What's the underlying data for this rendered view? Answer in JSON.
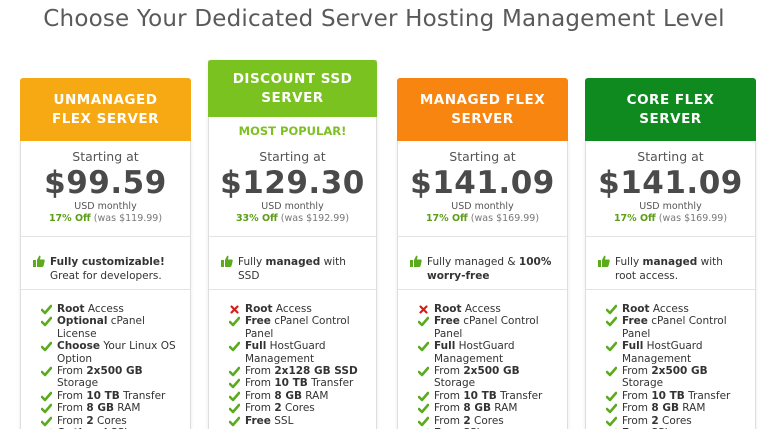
{
  "page_title": "Choose Your Dedicated Server Hosting Management Level",
  "colors": {
    "orange": "#f6a913",
    "green_light": "#7ac21f",
    "orange_dark": "#f7850f",
    "green_dark": "#0f8a1e",
    "check": "#5cab1e",
    "cross": "#d4201b"
  },
  "plans": [
    {
      "name": "UNMANAGED FLEX SERVER",
      "starting": "Starting at",
      "price": "$99.59",
      "per": "USD monthly",
      "discount_pct": "17% Off",
      "discount_was": "(was $119.99)",
      "feature_bold": "Fully customizable!",
      "feature_text": " Great for developers.",
      "specs": [
        {
          "ok": true,
          "bold": "Root",
          "text": " Access"
        },
        {
          "ok": true,
          "bold": "Optional",
          "text": " cPanel License"
        },
        {
          "ok": true,
          "bold": "Choose",
          "text": " Your Linux OS Option"
        },
        {
          "ok": true,
          "pre": "From ",
          "bold": "2x500 GB",
          "text": " Storage"
        },
        {
          "ok": true,
          "pre": "From ",
          "bold": "10 TB",
          "text": " Transfer"
        },
        {
          "ok": true,
          "pre": "From ",
          "bold": "8 GB",
          "text": " RAM"
        },
        {
          "ok": true,
          "pre": "From ",
          "bold": "2",
          "text": " Cores"
        },
        {
          "ok": true,
          "bold": "Optional",
          "text": " SSL"
        }
      ]
    },
    {
      "name": "DISCOUNT SSD SERVER",
      "badge": "MOST POPULAR!",
      "starting": "Starting at",
      "price": "$129.30",
      "per": "USD monthly",
      "discount_pct": "33% Off",
      "discount_was": "(was $192.99)",
      "feature_pre": "Fully ",
      "feature_bold": "managed",
      "feature_text": " with SSD",
      "specs": [
        {
          "ok": false,
          "bold": "Root",
          "text": " Access"
        },
        {
          "ok": true,
          "bold": "Free",
          "text": " cPanel Control Panel"
        },
        {
          "ok": true,
          "bold": "Full",
          "text": " HostGuard Management"
        },
        {
          "ok": true,
          "pre": "From ",
          "bold": "2x128 GB SSD",
          "text": ""
        },
        {
          "ok": true,
          "pre": "From ",
          "bold": "10 TB",
          "text": " Transfer"
        },
        {
          "ok": true,
          "pre": "From ",
          "bold": "8 GB",
          "text": " RAM"
        },
        {
          "ok": true,
          "pre": "From ",
          "bold": "2",
          "text": " Cores"
        },
        {
          "ok": true,
          "bold": "Free",
          "text": " SSL"
        }
      ]
    },
    {
      "name": "MANAGED FLEX SERVER",
      "starting": "Starting at",
      "price": "$141.09",
      "per": "USD monthly",
      "discount_pct": "17% Off",
      "discount_was": "(was $169.99)",
      "feature_pre": "Fully managed & ",
      "feature_bold": "100% worry-free",
      "feature_text": "",
      "specs": [
        {
          "ok": false,
          "bold": "Root",
          "text": " Access"
        },
        {
          "ok": true,
          "bold": "Free",
          "text": " cPanel Control Panel"
        },
        {
          "ok": true,
          "bold": "Full",
          "text": " HostGuard Management"
        },
        {
          "ok": true,
          "pre": "From ",
          "bold": "2x500 GB",
          "text": " Storage"
        },
        {
          "ok": true,
          "pre": "From ",
          "bold": "10 TB",
          "text": " Transfer"
        },
        {
          "ok": true,
          "pre": "From ",
          "bold": "8 GB",
          "text": " RAM"
        },
        {
          "ok": true,
          "pre": "From ",
          "bold": "2",
          "text": " Cores"
        },
        {
          "ok": true,
          "bold": "Free",
          "text": " SSL"
        }
      ]
    },
    {
      "name": "CORE FLEX SERVER",
      "starting": "Starting at",
      "price": "$141.09",
      "per": "USD monthly",
      "discount_pct": "17% Off",
      "discount_was": "(was $169.99)",
      "feature_pre": "Fully ",
      "feature_bold": "managed",
      "feature_text": " with root access.",
      "specs": [
        {
          "ok": true,
          "bold": "Root",
          "text": " Access"
        },
        {
          "ok": true,
          "bold": "Free",
          "text": " cPanel Control Panel"
        },
        {
          "ok": true,
          "bold": "Full",
          "text": " HostGuard Management"
        },
        {
          "ok": true,
          "pre": "From ",
          "bold": "2x500 GB",
          "text": " Storage"
        },
        {
          "ok": true,
          "pre": "From ",
          "bold": "10 TB",
          "text": " Transfer"
        },
        {
          "ok": true,
          "pre": "From ",
          "bold": "8 GB",
          "text": " RAM"
        },
        {
          "ok": true,
          "pre": "From ",
          "bold": "2",
          "text": " Cores"
        },
        {
          "ok": true,
          "bold": "Free",
          "text": " SSL"
        }
      ]
    }
  ]
}
